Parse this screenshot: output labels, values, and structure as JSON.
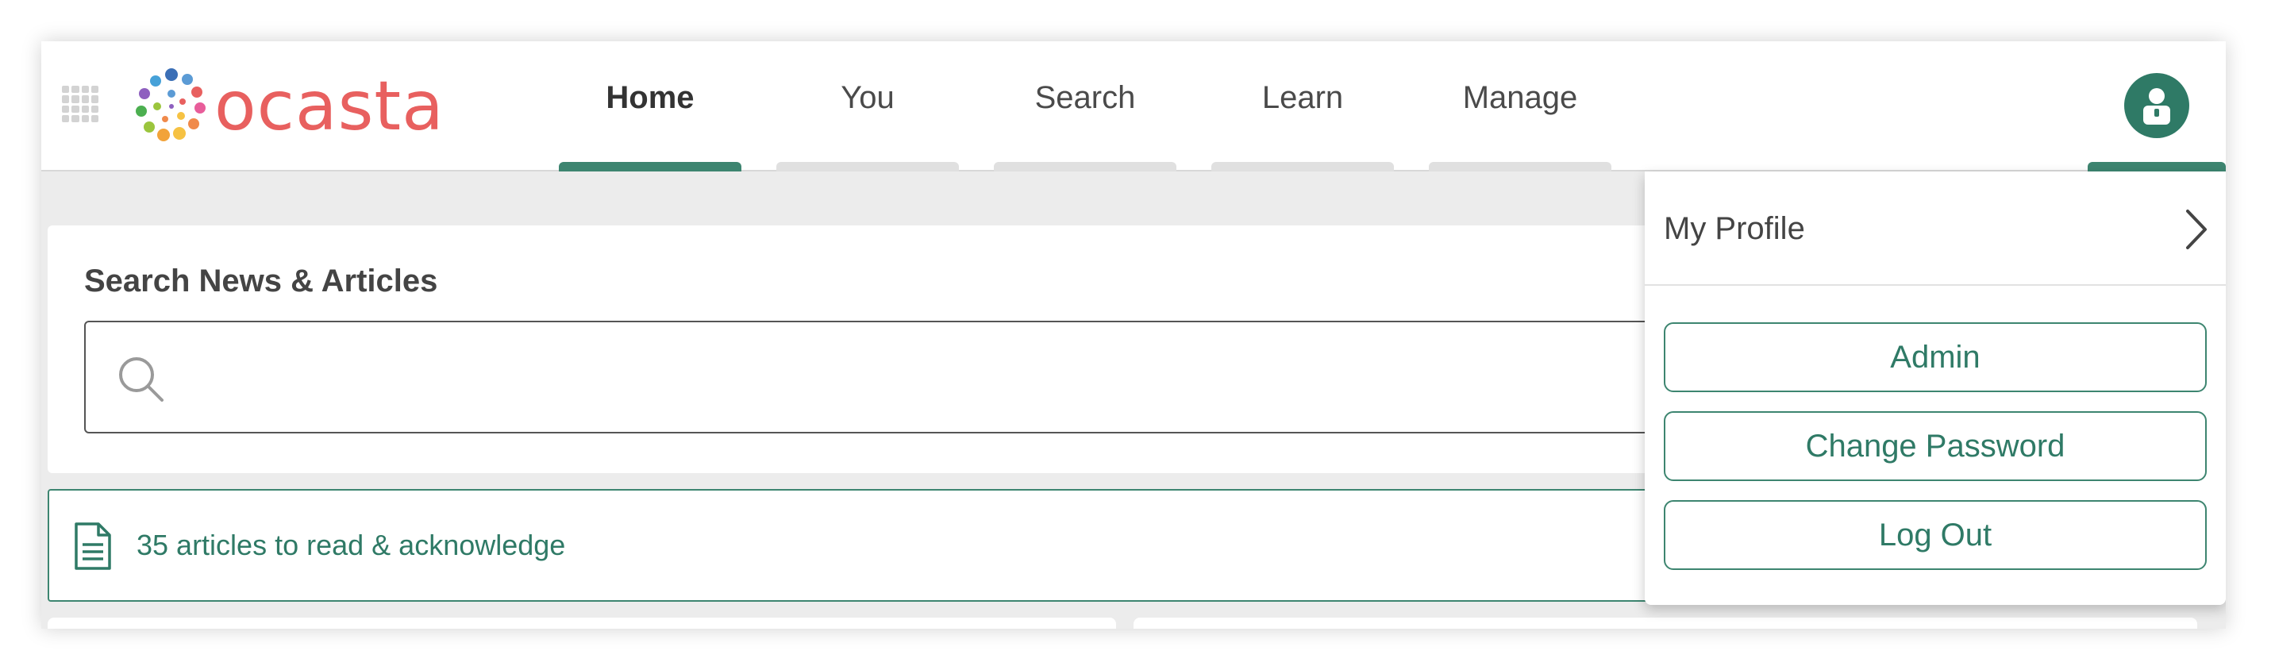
{
  "brand": {
    "name": "ocasta",
    "color": "#e8605f"
  },
  "nav": {
    "tabs": [
      {
        "label": "Home",
        "active": true
      },
      {
        "label": "You",
        "active": false
      },
      {
        "label": "Search",
        "active": false
      },
      {
        "label": "Learn",
        "active": false
      },
      {
        "label": "Manage",
        "active": false
      }
    ]
  },
  "search": {
    "title": "Search News & Articles",
    "value": "",
    "placeholder": ""
  },
  "articles_banner": {
    "text": "35 articles to read & acknowledge"
  },
  "profile_menu": {
    "my_profile": "My Profile",
    "buttons": [
      "Admin",
      "Change Password",
      "Log Out"
    ]
  },
  "colors": {
    "accent": "#3d8570",
    "accent_dark": "#2f7a66",
    "inactive_tab": "#e0e0e0"
  },
  "icons": [
    "apps-grid-icon",
    "search-icon",
    "document-icon",
    "user-icon",
    "chevron-right-icon"
  ]
}
